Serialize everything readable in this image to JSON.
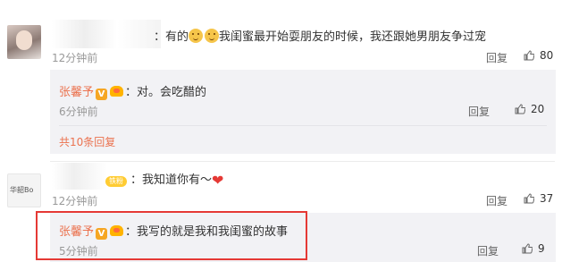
{
  "comment1": {
    "text_prefix": "：有的",
    "text_main": "我闺蜜最开始耍朋友的时候，我还跟她男朋友争过宠",
    "time": "12分钟前",
    "reply_label": "回复",
    "likes": "80"
  },
  "reply1": {
    "author": "张馨予",
    "v_badge": "V",
    "text": "：对。会吃醋的",
    "time": "6分钟前",
    "reply_label": "回复",
    "likes": "20"
  },
  "more_replies": "共10条回复",
  "comment2": {
    "avatar_text": "华韶Bo",
    "fan_badge": "铁粉",
    "text": "：我知道你有～",
    "time": "12分钟前",
    "reply_label": "回复",
    "likes": "37"
  },
  "reply2": {
    "author": "张馨予",
    "v_badge": "V",
    "text": "：我写的就是我和我闺蜜的故事",
    "time": "5分钟前",
    "reply_label": "回复",
    "likes": "9"
  },
  "colors": {
    "name": "#eb7350",
    "highlight": "#e53935",
    "reply_bg": "#f2f2f5"
  },
  "icons": [
    "smile-emoji-icon",
    "verified-v-icon",
    "crown-badge-icon",
    "thumb-up-icon",
    "heart-emoji-icon",
    "fan-badge-icon"
  ]
}
